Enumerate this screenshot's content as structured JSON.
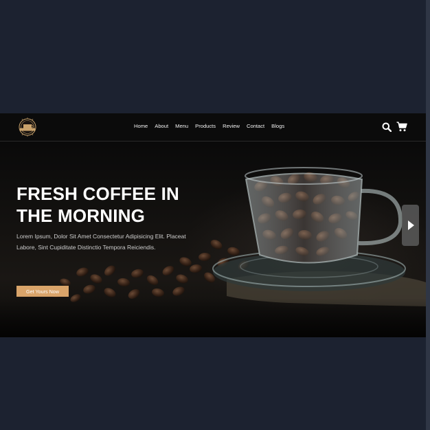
{
  "brand": {
    "logo_text": "COFFEE"
  },
  "nav": {
    "items": [
      "Home",
      "About",
      "Menu",
      "Products",
      "Review",
      "Contact",
      "Blogs"
    ]
  },
  "icons": {
    "search": "search-icon",
    "cart": "cart-icon",
    "next": "chevron-right-icon"
  },
  "hero": {
    "title": "FRESH COFFEE IN THE MORNING",
    "text": "Lorem Ipsum, Dolor Sit Amet Consectetur Adipisicing Elit. Placeat Labore, Sint Cupiditate Distinctio Tempora Reiciendis.",
    "cta_label": "Get Yours Now"
  },
  "colors": {
    "page_bg": "#1c2230",
    "header_bg": "#0b0b0b",
    "accent": "#d9a46a",
    "text": "#ffffff"
  }
}
